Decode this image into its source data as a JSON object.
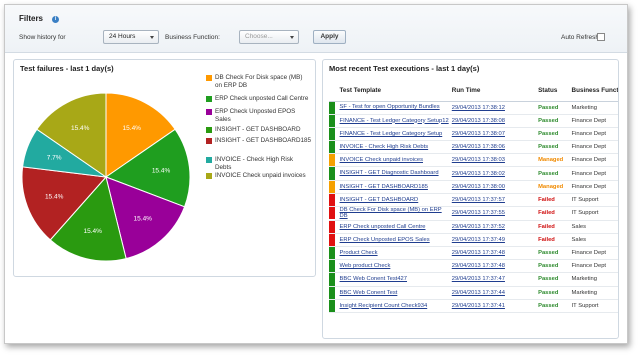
{
  "filters": {
    "title": "Filters",
    "history_label": "Show history for",
    "history_value": "24 Hours",
    "function_label": "Business Function:",
    "function_placeholder": "Choose...",
    "apply_label": "Apply",
    "auto_refresh_label": "Auto Refresh:"
  },
  "left_panel": {
    "title": "Test failures - last 1 day(s)"
  },
  "right_panel": {
    "title": "Most recent Test executions - last 1 day(s)"
  },
  "chart_data": {
    "type": "pie",
    "title": "",
    "slices": [
      {
        "label": "DB Check For Disk space (MB) on ERP DB",
        "value": 15.4,
        "color": "#ff9900"
      },
      {
        "label": "ERP Check unposted Call Centre",
        "value": 15.4,
        "color": "#1f9e1f"
      },
      {
        "label": "ERP Check Unposted EPOS Sales",
        "value": 15.4,
        "color": "#990099"
      },
      {
        "label": "INSIGHT - GET DASHBOARD",
        "value": 15.4,
        "color": "#2a9a10"
      },
      {
        "label": "INSIGHT - GET DASHBOARD185",
        "value": 15.4,
        "color": "#b22222"
      },
      {
        "label": "INVOICE - Check High Risk Debts",
        "value": 7.7,
        "color": "#22aaa0"
      },
      {
        "label": "INVOICE Check unpaid invoices",
        "value": 15.4,
        "color": "#a8a817"
      }
    ],
    "label_suffix": "%"
  },
  "table": {
    "headers": [
      "Test Template",
      "Run Time",
      "Status",
      "Business Function"
    ],
    "rows": [
      {
        "bar": "#1a8f1a",
        "template": "SF - Test for open Opportunity Bundles",
        "time": "29/04/2013 17:38:12",
        "status": "Passed",
        "fn": "Marketing"
      },
      {
        "bar": "#1a8f1a",
        "template": "FINANCE - Test Ledger Category Setup12",
        "time": "29/04/2013 17:38:08",
        "status": "Passed",
        "fn": "Finance Dept"
      },
      {
        "bar": "#1a8f1a",
        "template": "FINANCE - Test Ledger Category Setup",
        "time": "29/04/2013 17:38:07",
        "status": "Passed",
        "fn": "Finance Dept"
      },
      {
        "bar": "#1a8f1a",
        "template": "INVOICE - Check High Risk Debts",
        "time": "29/04/2013 17:38:06",
        "status": "Passed",
        "fn": "Finance Dept"
      },
      {
        "bar": "#f5a000",
        "template": "INVOICE Check unpaid invoices",
        "time": "29/04/2013 17:38:03",
        "status": "Managed",
        "fn": "Finance Dept"
      },
      {
        "bar": "#1a8f1a",
        "template": "INSIGHT - GET Diagnostic Dashboard",
        "time": "29/04/2013 17:38:02",
        "status": "Passed",
        "fn": "Finance Dept"
      },
      {
        "bar": "#f5a000",
        "template": "INSIGHT - GET DASHBOARD185",
        "time": "29/04/2013 17:38:00",
        "status": "Managed",
        "fn": "Finance Dept"
      },
      {
        "bar": "#e01010",
        "template": "INSIGHT - GET DASHBOARD",
        "time": "29/04/2013 17:37:57",
        "status": "Failed",
        "fn": "IT Support"
      },
      {
        "bar": "#e01010",
        "template": "DB Check For Disk space (MB) on ERP DB",
        "time": "29/04/2013 17:37:55",
        "status": "Failed",
        "fn": "IT Support"
      },
      {
        "bar": "#e01010",
        "template": "ERP Check unposted Call Centre",
        "time": "29/04/2013 17:37:52",
        "status": "Failed",
        "fn": "Sales"
      },
      {
        "bar": "#e01010",
        "template": "ERP Check Unposted EPOS Sales",
        "time": "29/04/2013 17:37:49",
        "status": "Failed",
        "fn": "Sales"
      },
      {
        "bar": "#1a8f1a",
        "template": "Product Check",
        "time": "29/04/2013 17:37:48",
        "status": "Passed",
        "fn": "Finance Dept"
      },
      {
        "bar": "#1a8f1a",
        "template": "Web product Check",
        "time": "29/04/2013 17:37:48",
        "status": "Passed",
        "fn": "Finance Dept"
      },
      {
        "bar": "#1a8f1a",
        "template": "BBC Web Conent Test427",
        "time": "29/04/2013 17:37:47",
        "status": "Passed",
        "fn": "Marketing"
      },
      {
        "bar": "#1a8f1a",
        "template": "BBC Web Conent Test",
        "time": "29/04/2013 17:37:44",
        "status": "Passed",
        "fn": "Marketing"
      },
      {
        "bar": "#1a8f1a",
        "template": "Insight Recipient Count Check934",
        "time": "29/04/2013 17:37:41",
        "status": "Passed",
        "fn": "IT Support"
      }
    ]
  }
}
